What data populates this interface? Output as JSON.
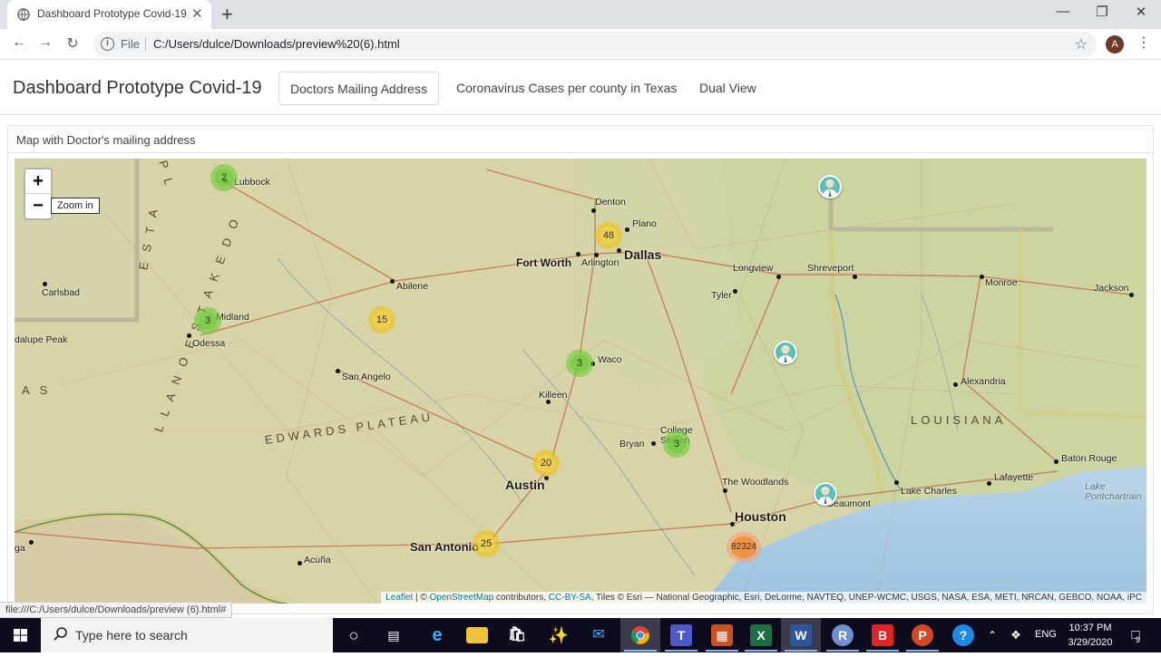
{
  "browser": {
    "tab_title": "Dashboard Prototype Covid-19",
    "tab_close": "✕",
    "new_tab": "+",
    "file_label": "File",
    "url": "C:/Users/dulce/Downloads/preview%20(6).html",
    "profile_initial": "A",
    "status_url": "file:///C:/Users/dulce/Downloads/preview (6).html#"
  },
  "app": {
    "title": "Dashboard Prototype Covid-19",
    "tabs": [
      {
        "label": "Doctors Mailing Address"
      },
      {
        "label": "Coronavirus Cases per county in Texas"
      },
      {
        "label": "Dual View"
      }
    ]
  },
  "panel": {
    "title": "Map with Doctor's mailing address"
  },
  "map": {
    "zoom_in": "+",
    "zoom_out": "−",
    "tooltip": "Zoom in",
    "attribution": {
      "leaflet": "Leaflet",
      "sep1": " | © ",
      "osm": "OpenStreetMap",
      "mid": " contributors, ",
      "license": "CC-BY-SA",
      "tail": ", Tiles © Esri — National Geographic, Esri, DeLorme, NAVTEQ, UNEP-WCMC, USGS, NASA, ESA, METI, NRCAN, GEBCO, NOAA, iPC"
    },
    "cities": [
      {
        "name": "Lubbock"
      },
      {
        "name": "Denton"
      },
      {
        "name": "Plano"
      },
      {
        "name": "Dallas"
      },
      {
        "name": "Fort Worth"
      },
      {
        "name": "Arlington"
      },
      {
        "name": "Longview"
      },
      {
        "name": "Shreveport"
      },
      {
        "name": "Monroe"
      },
      {
        "name": "Jackson"
      },
      {
        "name": "Tyler"
      },
      {
        "name": "Carlsbad"
      },
      {
        "name": "Abilene"
      },
      {
        "name": "Midland"
      },
      {
        "name": "Odessa"
      },
      {
        "name": "dalupe Peak"
      },
      {
        "name": "Waco"
      },
      {
        "name": "San Angelo"
      },
      {
        "name": "Killeen"
      },
      {
        "name": "Alexandria"
      },
      {
        "name": "College Station"
      },
      {
        "name": "Bryan"
      },
      {
        "name": "Austin"
      },
      {
        "name": "The Woodlands"
      },
      {
        "name": "Beaumont"
      },
      {
        "name": "Lake Charles"
      },
      {
        "name": "Lafayette"
      },
      {
        "name": "Baton Rouge"
      },
      {
        "name": "Houston"
      },
      {
        "name": "San Antonio"
      },
      {
        "name": "Acuña"
      },
      {
        "name": "Lake Pontchartrain"
      },
      {
        "name": "ga"
      }
    ],
    "regions": {
      "louisiana": "LOUISIANA",
      "edwards": "EDWARDS PLATEAU",
      "texas_left": "A S",
      "llano": "L L A N O   E S T A K E D O",
      "estacado": "E S T A",
      "pl": "P L"
    },
    "clusters": [
      {
        "count": "2",
        "level": "small"
      },
      {
        "count": "48",
        "level": "medium"
      },
      {
        "count": "3",
        "level": "small"
      },
      {
        "count": "15",
        "level": "medium"
      },
      {
        "count": "3",
        "level": "small"
      },
      {
        "count": "3",
        "level": "small"
      },
      {
        "count": "20",
        "level": "medium"
      },
      {
        "count": "25",
        "level": "medium"
      },
      {
        "count": "82324",
        "level": "large"
      }
    ],
    "doctor_markers": 3
  },
  "taskbar": {
    "search_placeholder": "Type here to search",
    "language": "ENG",
    "time": "10:37 PM",
    "date": "3/29/2020",
    "notification_count": "9"
  }
}
